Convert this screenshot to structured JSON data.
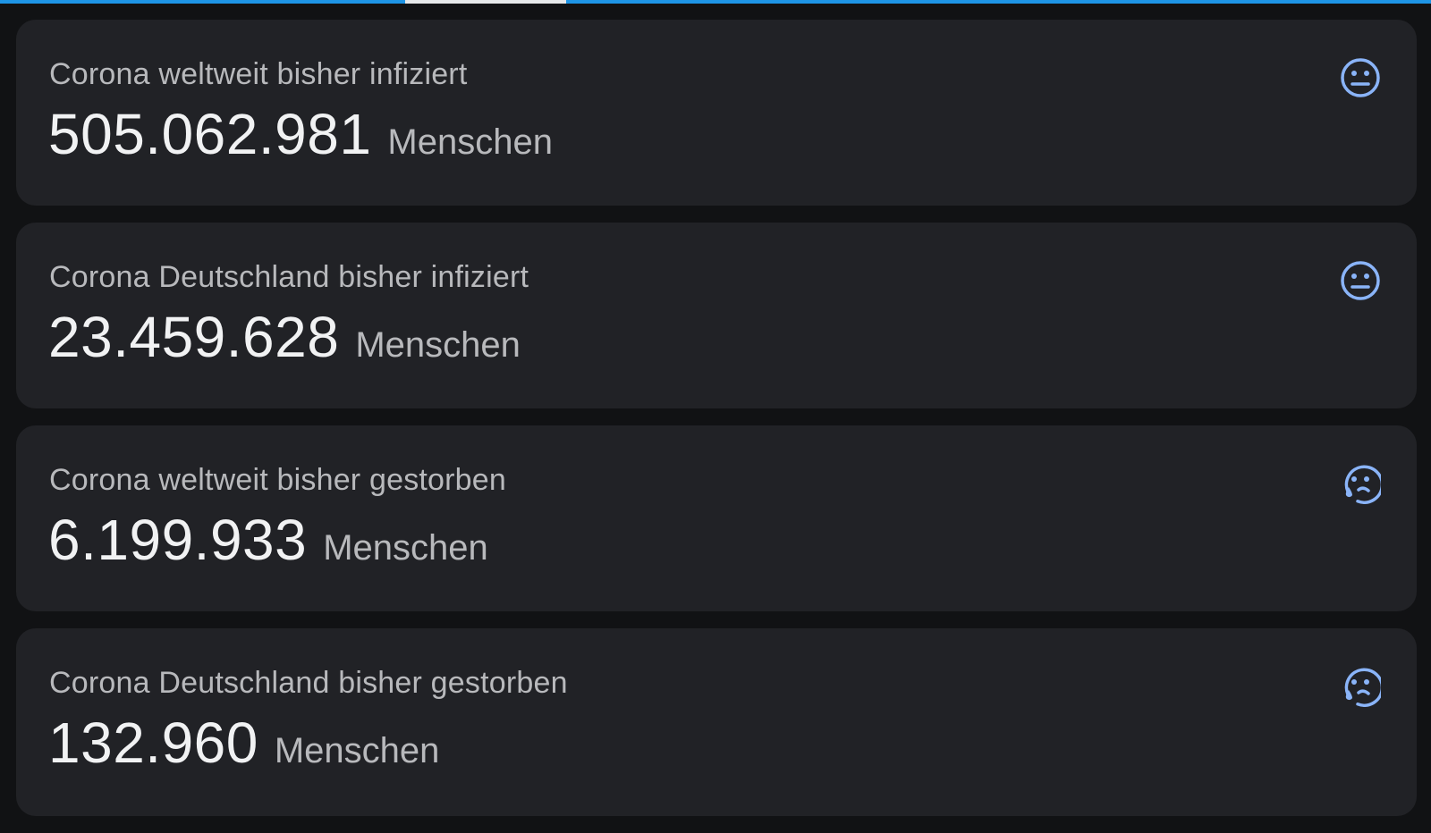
{
  "accent_color": "#1e95e6",
  "icon_color": "#8ab4f8",
  "cards": [
    {
      "title": "Corona weltweit bisher infiziert",
      "value": "505.062.981",
      "unit": "Menschen",
      "icon": "neutral-face-icon"
    },
    {
      "title": "Corona Deutschland bisher infiziert",
      "value": "23.459.628",
      "unit": "Menschen",
      "icon": "neutral-face-icon"
    },
    {
      "title": "Corona weltweit bisher gestorben",
      "value": "6.199.933",
      "unit": "Menschen",
      "icon": "crying-face-icon"
    },
    {
      "title": "Corona Deutschland bisher gestorben",
      "value": "132.960",
      "unit": "Menschen",
      "icon": "crying-face-icon"
    }
  ]
}
